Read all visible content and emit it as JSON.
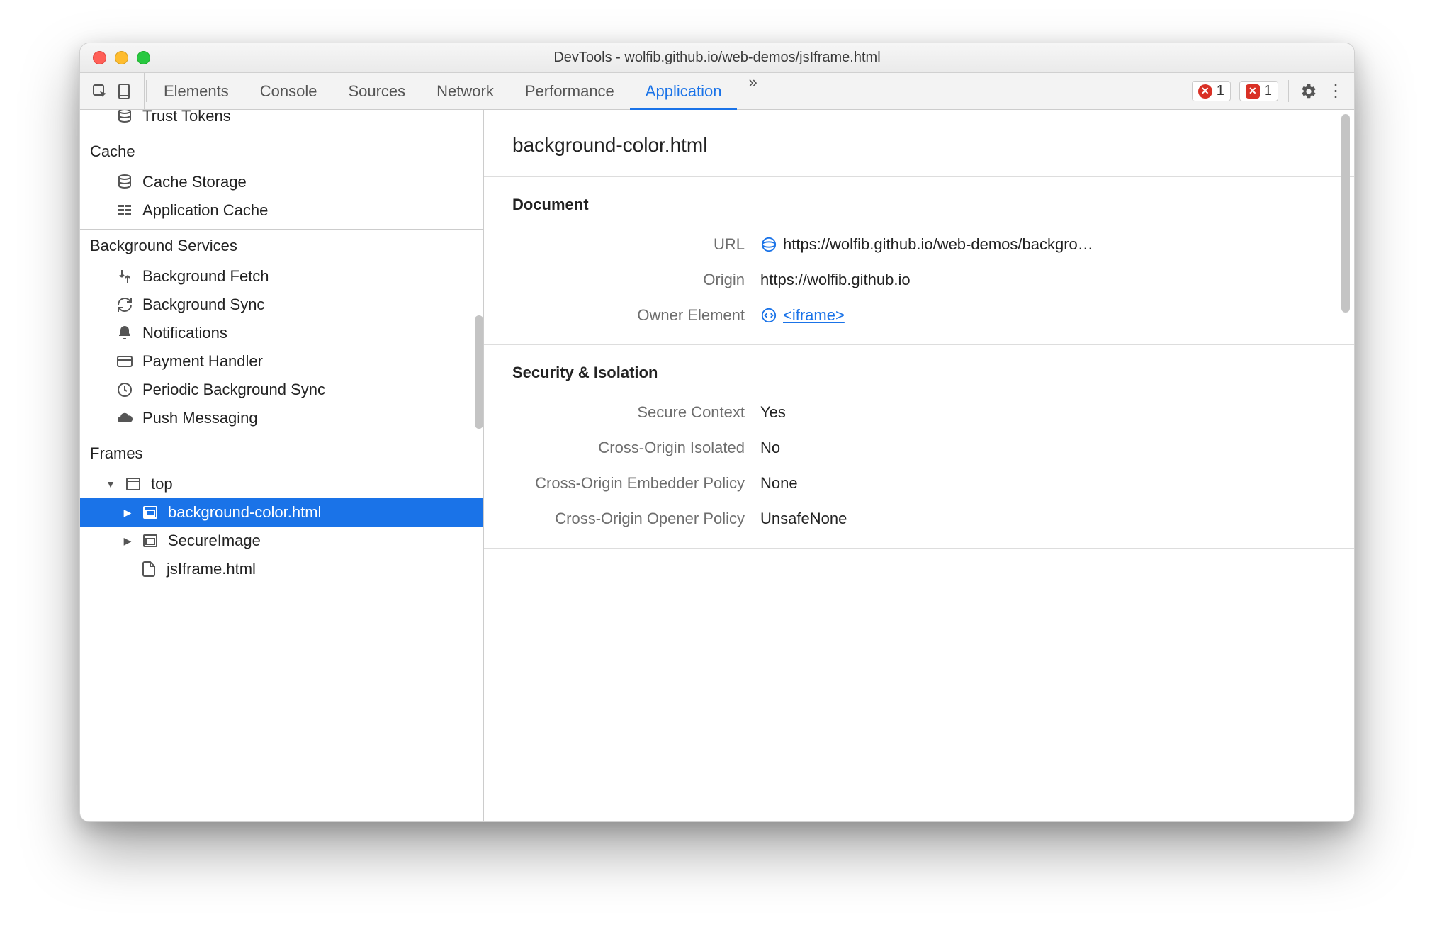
{
  "window": {
    "title": "DevTools - wolfib.github.io/web-demos/jsIframe.html"
  },
  "tabs": {
    "items": [
      "Elements",
      "Console",
      "Sources",
      "Network",
      "Performance",
      "Application"
    ],
    "active": "Application",
    "overflow": "»",
    "error_count": "1",
    "issue_count": "1"
  },
  "sidebar": {
    "trust_tokens": "Trust Tokens",
    "cache_header": "Cache",
    "cache_storage": "Cache Storage",
    "application_cache": "Application Cache",
    "bg_header": "Background Services",
    "bg_fetch": "Background Fetch",
    "bg_sync": "Background Sync",
    "notifications": "Notifications",
    "payment_handler": "Payment Handler",
    "periodic_bg_sync": "Periodic Background Sync",
    "push_messaging": "Push Messaging",
    "frames_header": "Frames",
    "top": "top",
    "frame_bgcolor": "background-color.html",
    "frame_secureimage": "SecureImage",
    "frame_jsiframe": "jsIframe.html"
  },
  "main": {
    "title": "background-color.html",
    "document_header": "Document",
    "url_label": "URL",
    "url_value": "https://wolfib.github.io/web-demos/backgro…",
    "origin_label": "Origin",
    "origin_value": "https://wolfib.github.io",
    "owner_label": "Owner Element",
    "owner_value": "<iframe>",
    "security_header": "Security & Isolation",
    "secure_context_label": "Secure Context",
    "secure_context_value": "Yes",
    "coi_label": "Cross-Origin Isolated",
    "coi_value": "No",
    "coep_label": "Cross-Origin Embedder Policy",
    "coep_value": "None",
    "coop_label": "Cross-Origin Opener Policy",
    "coop_value": "UnsafeNone"
  }
}
